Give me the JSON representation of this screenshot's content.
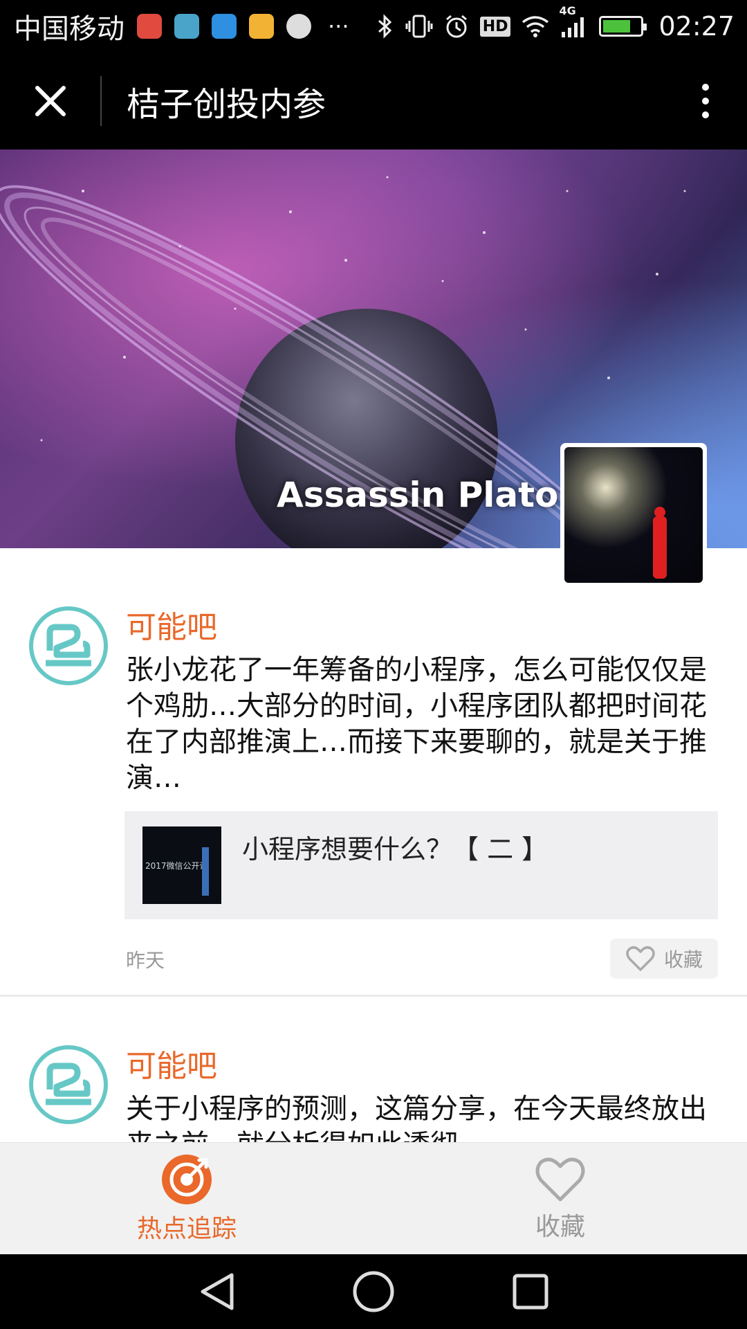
{
  "status_bar": {
    "carrier": "中国移动",
    "overflow_dots": "···",
    "network": "4G",
    "hd_badge": "HD",
    "time": "02:27",
    "battery_level": 0.75
  },
  "title_bar": {
    "title": "桔子创投内参"
  },
  "banner": {
    "profile_name": "Assassin Plato"
  },
  "posts": [
    {
      "author": "可能吧",
      "body": "张小龙花了一年筹备的小程序，怎么可能仅仅是个鸡肋…大部分的时间，小程序团队都把时间花在了内部推演上…而接下来要聊的，就是关于推演…",
      "link_title": "小程序想要什么？【 二 】",
      "link_thumb_text": "2017微信公开课",
      "time": "昨天",
      "favorite_label": "收藏"
    },
    {
      "author": "可能吧",
      "body": "关于小程序的预测，这篇分享，在今天最终放出来之前，就分析得如此透彻…"
    }
  ],
  "tabs": [
    {
      "label": "热点追踪",
      "icon": "target-icon",
      "active": true
    },
    {
      "label": "收藏",
      "icon": "heart-icon",
      "active": false
    }
  ],
  "colors": {
    "accent": "#e9682a",
    "avatar_ring": "#66c8c6",
    "muted": "#999999"
  }
}
